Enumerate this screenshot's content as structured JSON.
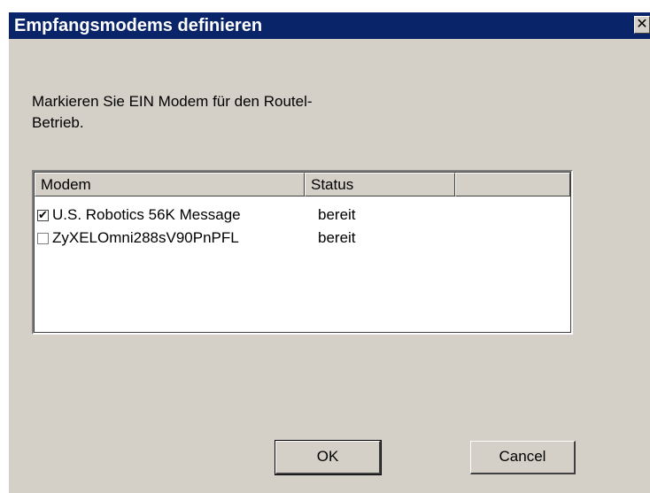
{
  "window": {
    "title": "Empfangsmodems definieren",
    "close_icon": "close-icon"
  },
  "instruction": "Markieren Sie EIN Modem für den Routel-Betrieb.",
  "list": {
    "columns": [
      "Modem",
      "Status",
      ""
    ],
    "rows": [
      {
        "name": "U.S. Robotics 56K Message",
        "status": "bereit",
        "checked": true
      },
      {
        "name": "ZyXELOmni288sV90PnPFL",
        "status": "bereit",
        "checked": false
      }
    ]
  },
  "buttons": {
    "ok": "OK",
    "cancel": "Cancel"
  },
  "colors": {
    "titlebar": "#0a246a",
    "dialog_bg": "#d4d0c8"
  }
}
